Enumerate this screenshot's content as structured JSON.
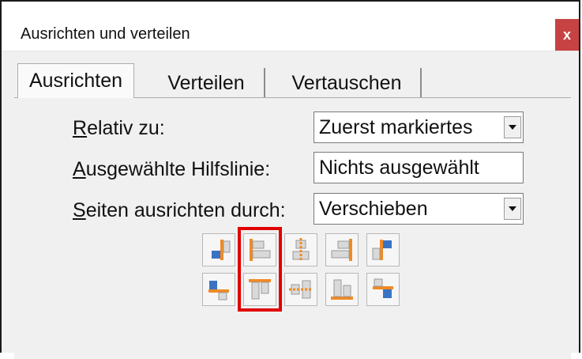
{
  "window": {
    "title": "Ausrichten und verteilen",
    "close_label": "x"
  },
  "tabs": [
    {
      "label": "Ausrichten",
      "active": true
    },
    {
      "label": "Verteilen",
      "active": false
    },
    {
      "label": "Vertauschen",
      "active": false
    }
  ],
  "form": {
    "relative_to": {
      "label_u": "R",
      "label_rest": "elativ zu:",
      "value": "Zuerst markiertes"
    },
    "guide": {
      "label_u": "A",
      "label_rest": "usgewählte Hilfslinie:",
      "value": "Nichts ausgewählt"
    },
    "align_sides": {
      "label_u": "S",
      "label_rest": "eiten ausrichten durch:",
      "value": "Verschieben"
    }
  },
  "align_buttons": {
    "row1": [
      "align-left-edges-icon",
      "align-left-icon",
      "align-horizontal-centers-icon",
      "align-right-icon",
      "align-right-edges-icon"
    ],
    "row2": [
      "align-top-edges-icon",
      "align-top-icon",
      "align-vertical-centers-icon",
      "align-bottom-icon",
      "align-bottom-edges-icon"
    ]
  },
  "colors": {
    "accent_orange": "#f08a24",
    "accent_blue": "#3a73c4",
    "highlight": "#e00000"
  }
}
